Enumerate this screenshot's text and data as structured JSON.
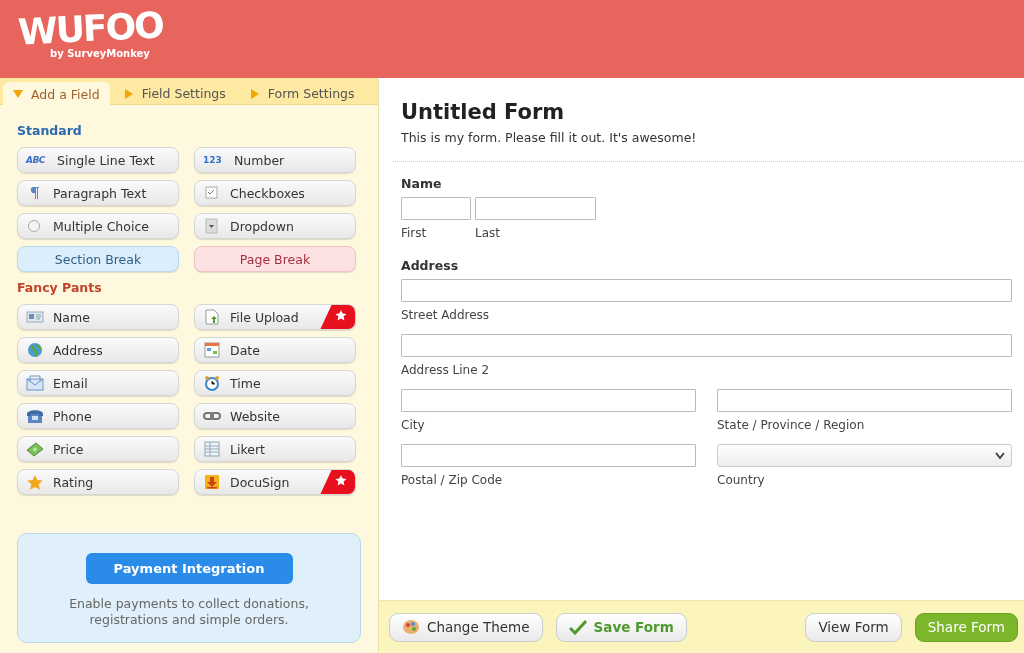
{
  "logo": {
    "name": "WUFOO",
    "tagline": "by SurveyMonkey"
  },
  "tabs": [
    {
      "label": "Add a Field",
      "selected": true
    },
    {
      "label": "Field Settings",
      "selected": false
    },
    {
      "label": "Form Settings",
      "selected": false
    }
  ],
  "groups": [
    {
      "title": "Standard",
      "kind": "standard",
      "items": [
        {
          "label": "Single Line Text",
          "kind": "abc",
          "icon_text": "ABC",
          "badge": false
        },
        {
          "label": "Number",
          "kind": "number",
          "icon_text": "123",
          "badge": false
        },
        {
          "label": "Paragraph Text",
          "kind": "paragraph",
          "badge": false
        },
        {
          "label": "Checkboxes",
          "kind": "checkbox",
          "badge": false
        },
        {
          "label": "Multiple Choice",
          "kind": "radio",
          "badge": false
        },
        {
          "label": "Dropdown",
          "kind": "dropdown",
          "badge": false
        },
        {
          "label": "Section Break",
          "kind": "section",
          "badge": false
        },
        {
          "label": "Page Break",
          "kind": "page",
          "badge": false
        }
      ]
    },
    {
      "title": "Fancy Pants",
      "kind": "fancy",
      "items": [
        {
          "label": "Name",
          "kind": "card",
          "badge": false
        },
        {
          "label": "File Upload",
          "kind": "file",
          "badge": true
        },
        {
          "label": "Address",
          "kind": "globe",
          "badge": false
        },
        {
          "label": "Date",
          "kind": "calendar",
          "badge": false
        },
        {
          "label": "Email",
          "kind": "envelope",
          "badge": false
        },
        {
          "label": "Time",
          "kind": "clock",
          "badge": false
        },
        {
          "label": "Phone",
          "kind": "phone",
          "badge": false
        },
        {
          "label": "Website",
          "kind": "link",
          "badge": false
        },
        {
          "label": "Price",
          "kind": "money",
          "badge": false
        },
        {
          "label": "Likert",
          "kind": "table",
          "badge": false
        },
        {
          "label": "Rating",
          "kind": "star",
          "badge": false
        },
        {
          "label": "DocuSign",
          "kind": "download",
          "badge": true
        }
      ]
    }
  ],
  "payment": {
    "button": "Payment Integration",
    "text": "Enable payments to collect donations, registrations and simple orders."
  },
  "form": {
    "title": "Untitled Form",
    "description": "This is my form. Please fill it out. It's awesome!",
    "fields": [
      {
        "kind": "name",
        "label": "Name",
        "parts": [
          {
            "label": "First",
            "kind": "text"
          },
          {
            "label": "Last",
            "kind": "text"
          }
        ]
      },
      {
        "kind": "address",
        "label": "Address",
        "parts": [
          {
            "label": "Street Address",
            "kind": "text"
          },
          {
            "label": "Address Line 2",
            "kind": "text"
          },
          {
            "label": "City",
            "kind": "text"
          },
          {
            "label": "State / Province / Region",
            "kind": "text"
          },
          {
            "label": "Postal / Zip Code",
            "kind": "text"
          },
          {
            "label": "Country",
            "kind": "select"
          }
        ]
      }
    ]
  },
  "footer": {
    "left": [
      {
        "label": "Change Theme",
        "kind": "theme"
      },
      {
        "label": "Save Form",
        "kind": "save"
      }
    ],
    "right": [
      {
        "label": "View Form",
        "kind": "plain"
      },
      {
        "label": "Share Form",
        "kind": "primary"
      }
    ]
  }
}
